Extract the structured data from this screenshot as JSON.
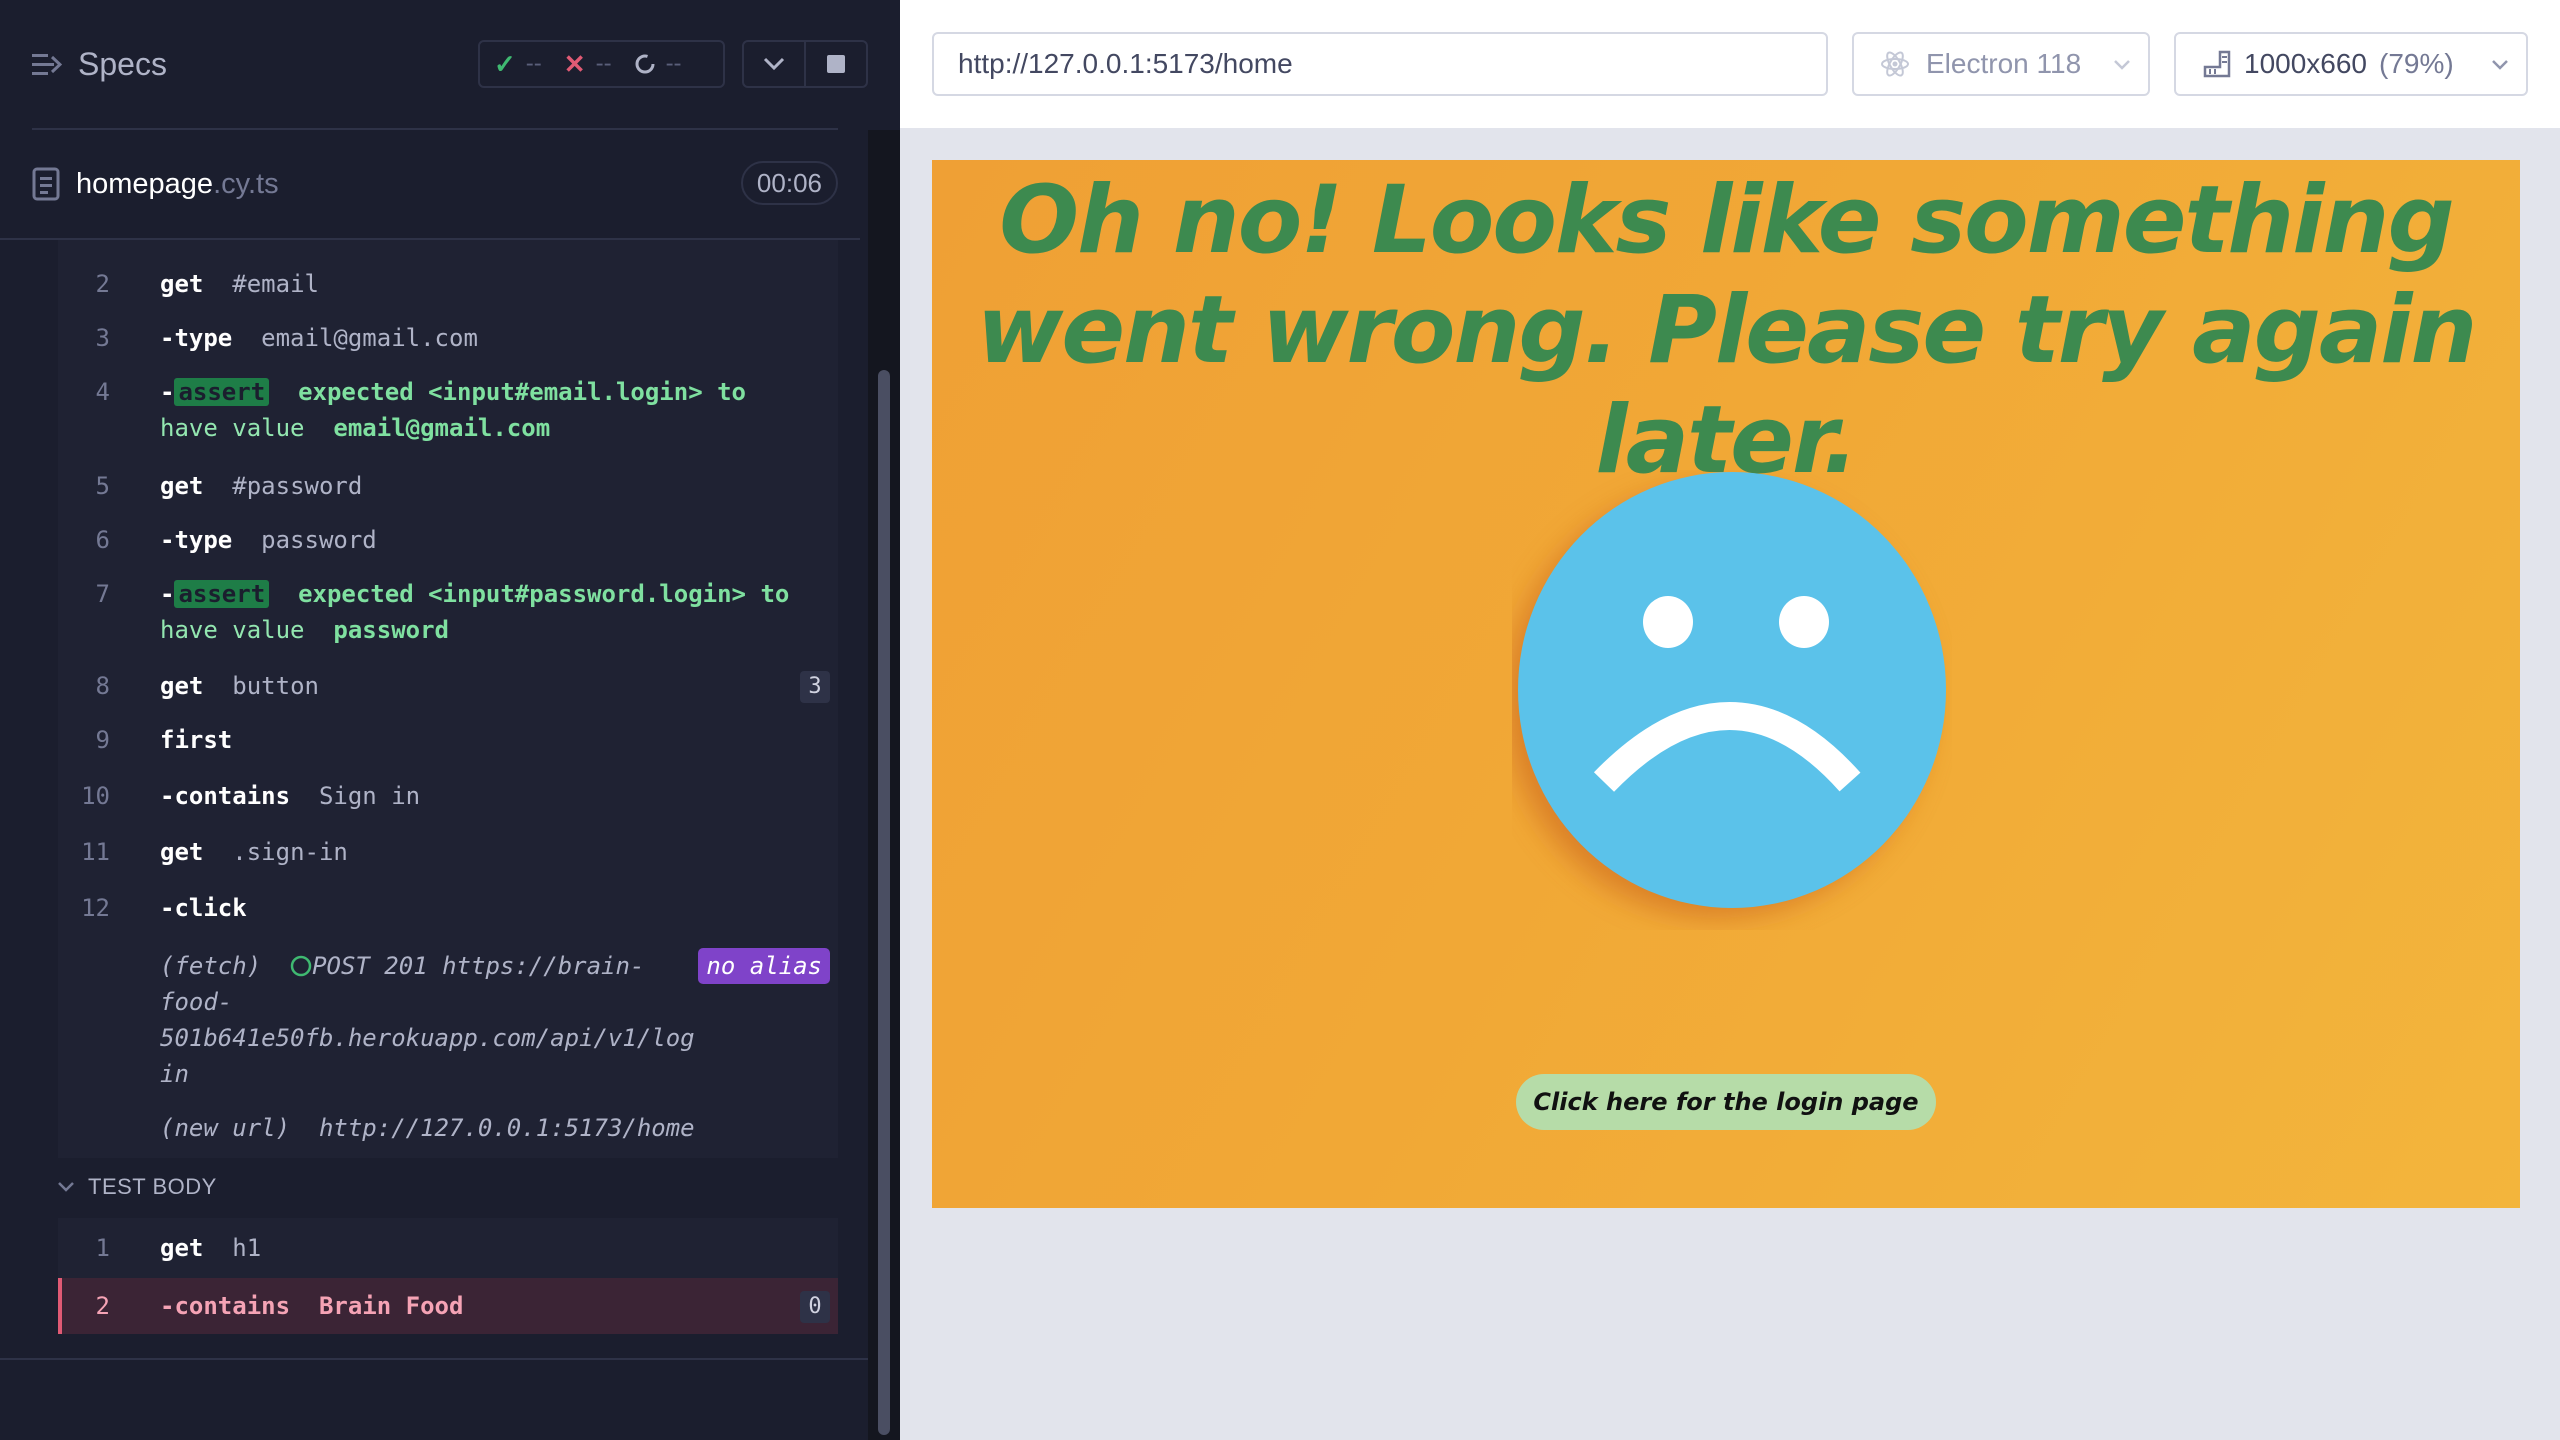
{
  "reporter": {
    "specs_label": "Specs",
    "stats": {
      "passed": "--",
      "failed": "--",
      "pending": "--"
    },
    "spec": {
      "name": "homepage",
      "ext": ".cy.ts",
      "duration": "00:06"
    },
    "hook_commands": [
      {
        "num": "2",
        "name": "get",
        "msg": "#email"
      },
      {
        "num": "3",
        "name": "-type",
        "msg": "email@gmail.com"
      },
      {
        "num": "4",
        "name": "assert",
        "line1": "expected  <input#email.login>  to",
        "line2a": "have value",
        "line2b": "email@gmail.com"
      },
      {
        "num": "5",
        "name": "get",
        "msg": "#password"
      },
      {
        "num": "6",
        "name": "-type",
        "msg": "password"
      },
      {
        "num": "7",
        "name": "assert",
        "line1": "expected  <input#password.login>  to",
        "line2a": "have value",
        "line2b": "password"
      },
      {
        "num": "8",
        "name": "get",
        "msg": "button",
        "badge": "3"
      },
      {
        "num": "9",
        "name": "first",
        "msg": ""
      },
      {
        "num": "10",
        "name": "-contains",
        "msg": "Sign in"
      },
      {
        "num": "11",
        "name": "get",
        "msg": ".sign-in"
      },
      {
        "num": "12",
        "name": "-click",
        "msg": ""
      }
    ],
    "fetch": {
      "label": "(fetch)",
      "line1": "POST 201 https://brain-",
      "line2": "food-",
      "line3": "501b641e50fb.herokuapp.com/api/v1/log",
      "line4": "in",
      "alias": "no alias"
    },
    "new_url": {
      "label": "(new url)",
      "value": "http://127.0.0.1:5173/home"
    },
    "test_body_label": "TEST BODY",
    "test_body_commands": [
      {
        "num": "1",
        "name": "get",
        "msg": "h1"
      },
      {
        "num": "2",
        "name": "-contains",
        "msg": "Brain Food",
        "badge": "0"
      }
    ]
  },
  "aut": {
    "url": "http://127.0.0.1:5173/home",
    "browser": "Electron 118",
    "viewport": "1000x660",
    "scale": "(79%)",
    "page": {
      "heading": "Oh no! Looks like something went wrong. Please try again later.",
      "button": "Click here for the login page"
    }
  },
  "colors": {
    "panel_bg": "#1b1e2e",
    "heading_green": "#3d8a4f",
    "face_blue": "#5bc2ea",
    "button_bg": "#b6dca8",
    "fail_red": "#e05a74"
  }
}
